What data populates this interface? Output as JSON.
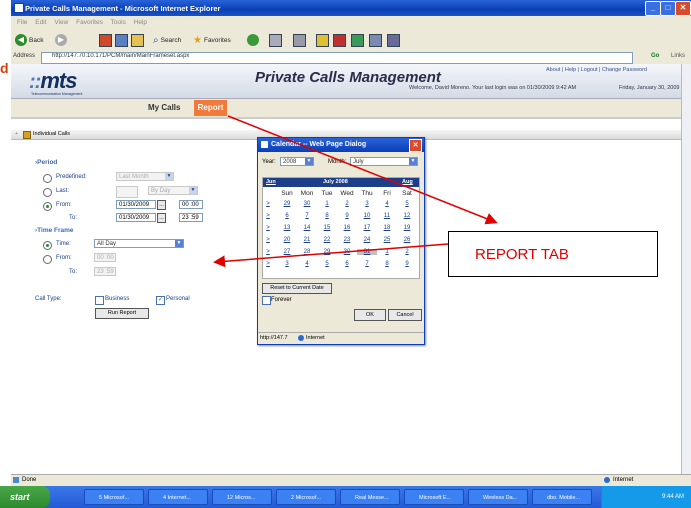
{
  "window": {
    "title": "Private Calls Management - Microsoft Internet Explorer",
    "controls": {
      "minimize": "_",
      "maximize": "□",
      "close": "✕"
    }
  },
  "menu": [
    "File",
    "Edit",
    "View",
    "Favorites",
    "Tools",
    "Help"
  ],
  "toolbar": {
    "back_label": "Back",
    "search_label": "Search",
    "favorites_label": "Favorites"
  },
  "address": {
    "label": "Address",
    "url": "http://147.70.10.171/PCM/main/MainFrameset.aspx",
    "go_label": "Go",
    "links_label": "Links"
  },
  "app": {
    "logo": "mts",
    "logo_hash": "::",
    "logo_sub": "Telecommunication Management",
    "title": "Private Calls Management",
    "toplinks": "About | Help | Logout | Change Password",
    "welcome": "Welcome, David Moreno. Your last login was on 01/30/2009 9:42 AM",
    "date": "Friday, January 30, 2009",
    "tabs": {
      "my_calls": "My Calls",
      "report": "Report"
    },
    "breadcrumb": "Individual Calls"
  },
  "form": {
    "period_label": "Period",
    "predefined_label": "Predefined:",
    "predefined_value": "Last Month",
    "last_label": "Last:",
    "last_unit": "By Day",
    "from_label": "From:",
    "from_date": "01/30/2009",
    "from_time": "00 :00",
    "to_label": "To:",
    "to_date": "01/30/2009",
    "to_time": "23 :59",
    "timeframe_label": "Time Frame",
    "time_label": "Time:",
    "time_value": "All Day",
    "tf_from_label": "From:",
    "tf_from_value": "00 :00",
    "tf_to_label": "To:",
    "tf_to_value": "23 :59",
    "calltype_label": "Call Type:",
    "business_label": "Business",
    "personal_label": "Personal",
    "run_button": "Run Report",
    "date_picker_button": "..."
  },
  "dialog": {
    "title": "Calendar -- Web Page Dialog",
    "year_label": "Year:",
    "year_value": "2008",
    "month_label": "Month:",
    "month_value": "July",
    "prev": "Jun",
    "month_year": "July 2008",
    "next": "Aug",
    "days_of_week": [
      "Sun",
      "Mon",
      "Tue",
      "Wed",
      "Thu",
      "Fri",
      "Sat"
    ],
    "weeks": [
      [
        "29",
        "30",
        "1",
        "2",
        "3",
        "4",
        "5"
      ],
      [
        "6",
        "7",
        "8",
        "9",
        "10",
        "11",
        "12"
      ],
      [
        "13",
        "14",
        "15",
        "16",
        "17",
        "18",
        "19"
      ],
      [
        "20",
        "21",
        "22",
        "23",
        "24",
        "25",
        "26"
      ],
      [
        "27",
        "28",
        "29",
        "30",
        "31",
        "1",
        "2"
      ],
      [
        "3",
        "4",
        "5",
        "6",
        "7",
        "8",
        "9"
      ]
    ],
    "week_marker": ">",
    "reset_button": "Reset to Current Date",
    "forever_label": "Forever",
    "ok_button": "OK",
    "cancel_button": "Cancel",
    "status_url": "http://147.7",
    "status_zone": "Internet"
  },
  "statusbar": {
    "left": "Done",
    "right": "Internet"
  },
  "taskbar": {
    "start_label": "start",
    "tasks": [
      "5 Microsof...",
      "4 Internet...",
      "12 Micros...",
      "2 Microsof...",
      "Real Messe...",
      "Microsoft E...",
      "Wireless Da...",
      "dbo. Mobile..."
    ],
    "clock": "9:44 AM"
  },
  "annotation": {
    "text": "REPORT TAB",
    "color": "#e00000"
  },
  "colors": {
    "accent_tab": "#f07a3a",
    "title_bar": "#0a3fb5",
    "arrow": "#e00000"
  },
  "edge_mark": "d"
}
